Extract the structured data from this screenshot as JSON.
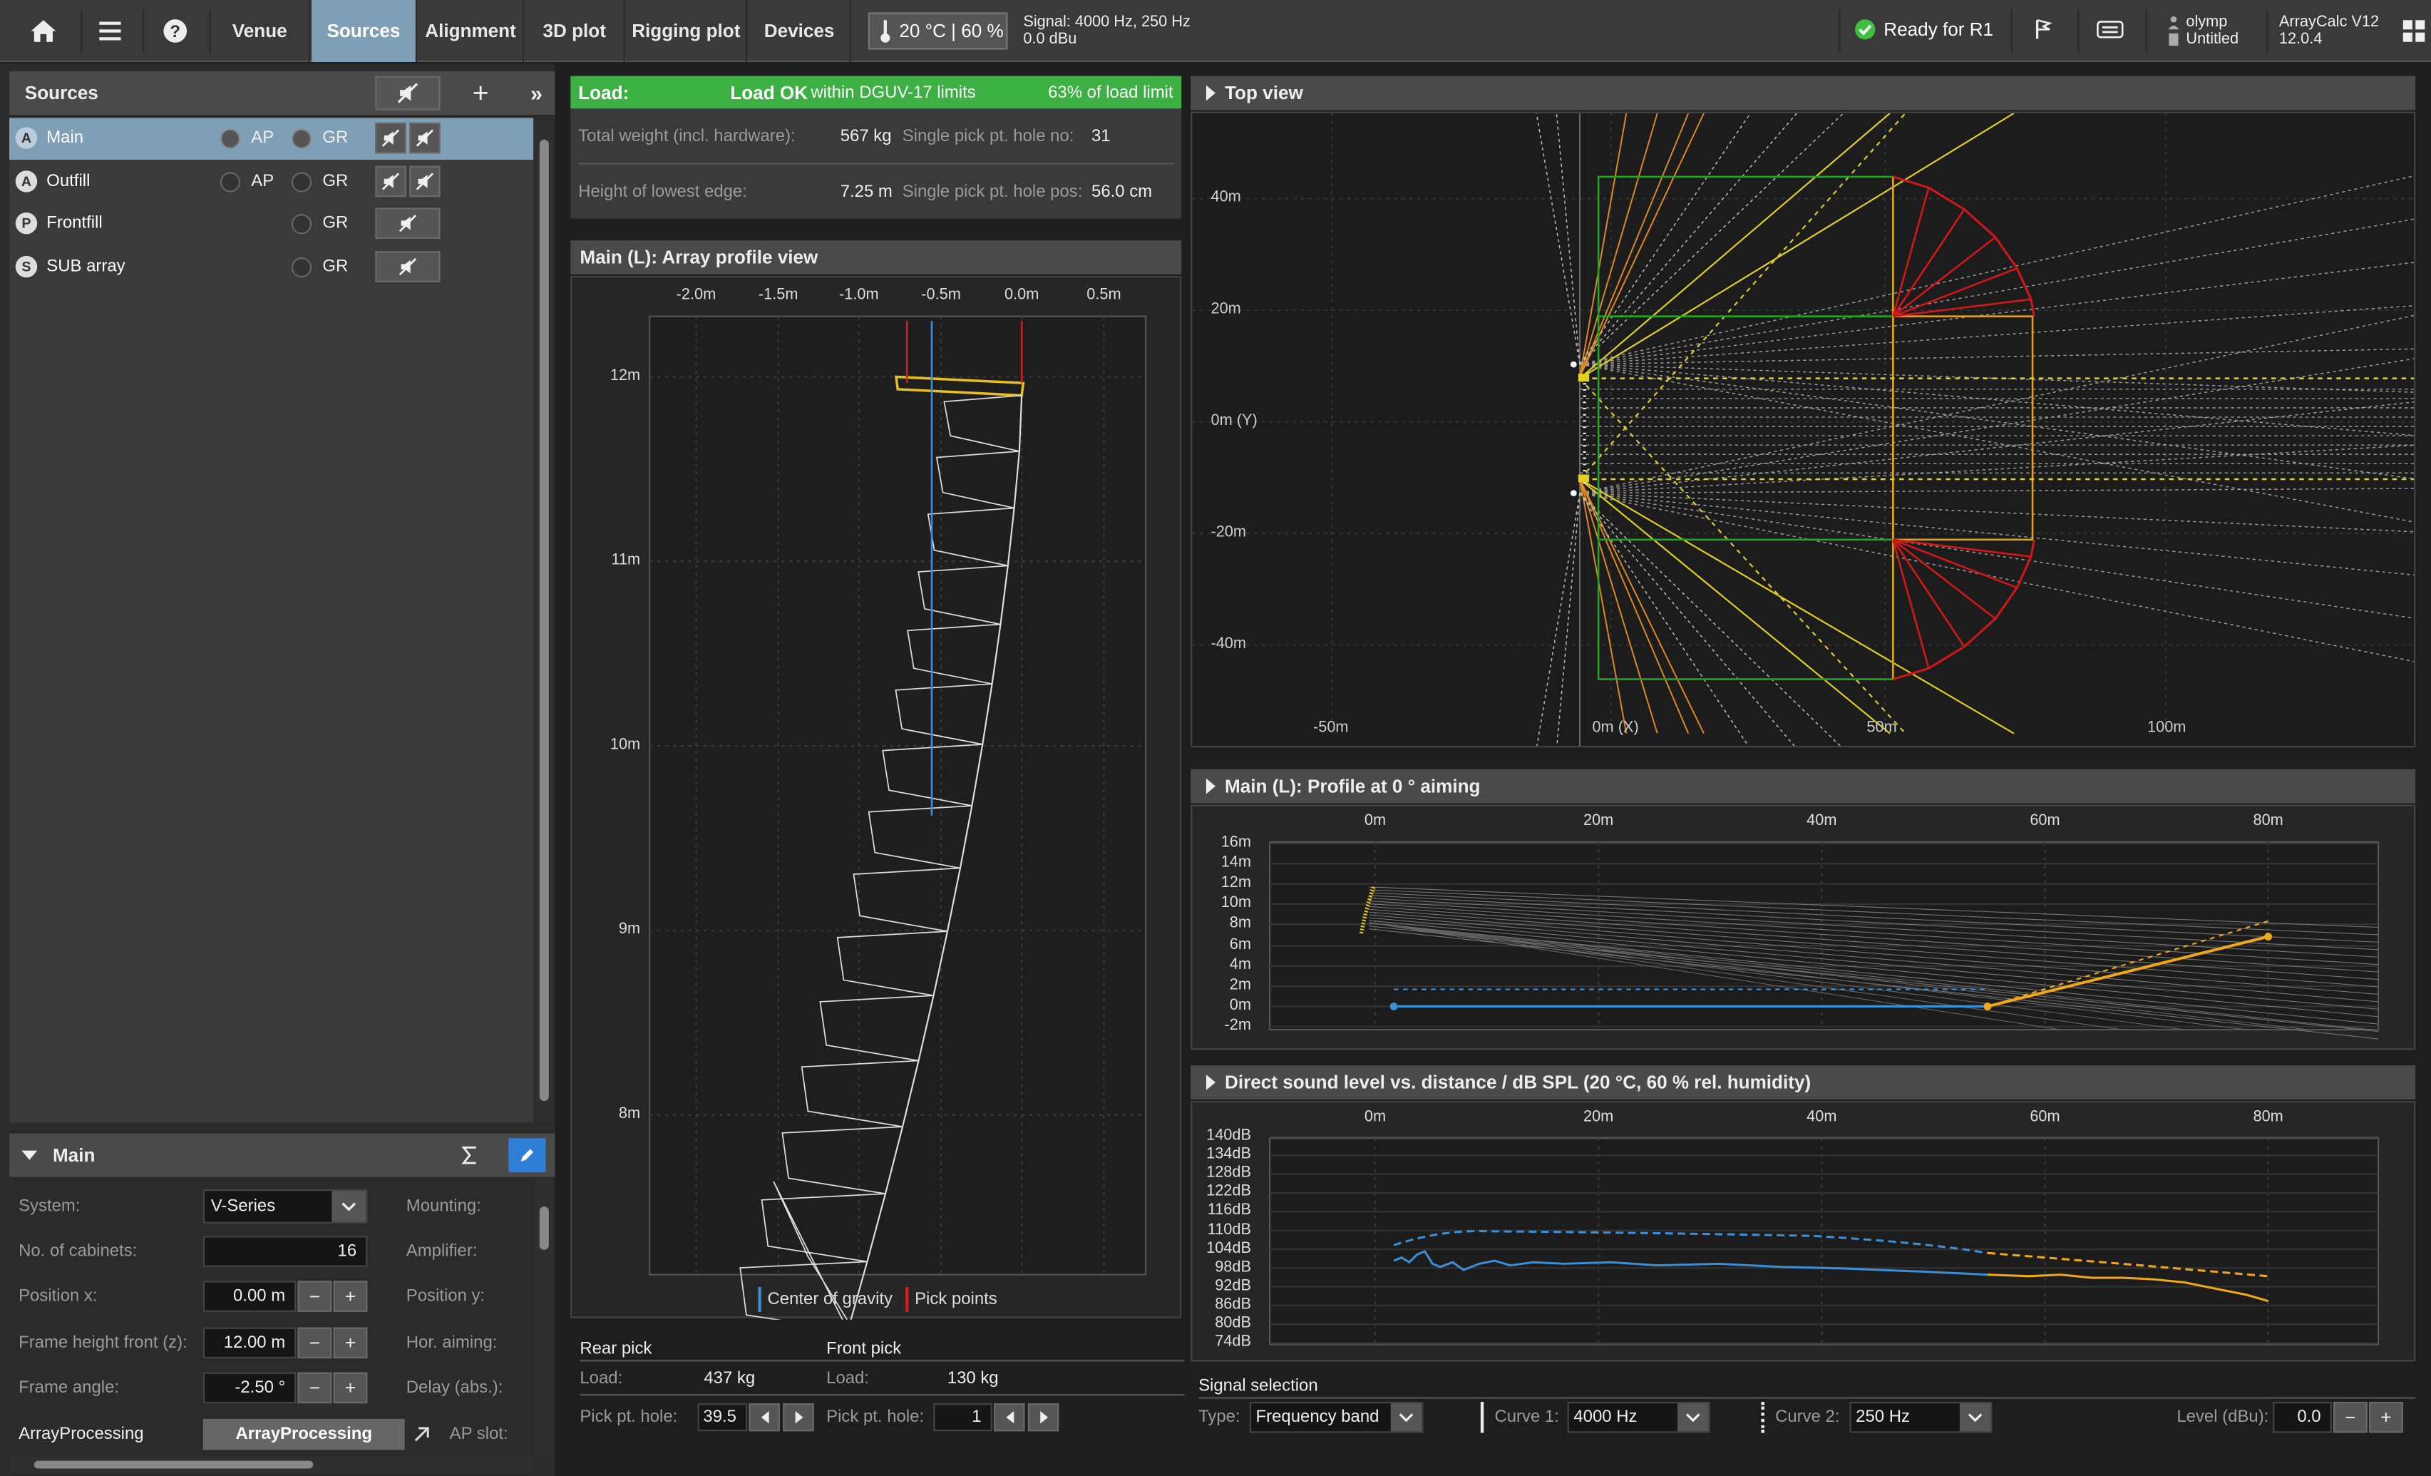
{
  "topbar": {
    "home_icon": "home-icon",
    "menu_icon": "menu-icon",
    "help_icon": "help-icon",
    "tabs": [
      "Venue",
      "Sources",
      "Alignment",
      "3D plot",
      "Rigging plot",
      "Devices"
    ],
    "active_tab": "Sources",
    "climate": "20 °C | 60 %",
    "signal_line1": "Signal: 4000 Hz, 250 Hz",
    "signal_line2": "0.0 dBu",
    "ready": "Ready for R1",
    "user": "olymp",
    "project": "Untitled",
    "app_name": "ArrayCalc V12",
    "app_version": "12.0.4",
    "colors": {
      "active": "#7f9fb6",
      "ready": "#3fbf3f"
    }
  },
  "sources": {
    "title": "Sources",
    "list": [
      {
        "badge": "A",
        "name": "Main",
        "ap": "AP",
        "gr": "GR"
      },
      {
        "badge": "A",
        "name": "Outfill",
        "ap": "AP",
        "gr": "GR"
      },
      {
        "badge": "P",
        "name": "Frontfill",
        "ap": "",
        "gr": "GR"
      },
      {
        "badge": "S",
        "name": "SUB array",
        "ap": "",
        "gr": "GR"
      }
    ]
  },
  "main_panel": {
    "title": "Main",
    "system_label": "System:",
    "system_value": "V-Series",
    "cabinets_label": "No. of cabinets:",
    "cabinets_value": "16",
    "posx_label": "Position x:",
    "posx_value": "0.00 m",
    "frameh_label": "Frame height front (z):",
    "frameh_value": "12.00 m",
    "frame_angle_label": "Frame angle:",
    "frame_angle_value": "-2.50 °",
    "ap_label": "ArrayProcessing",
    "ap_button": "ArrayProcessing",
    "mounting_label": "Mounting:",
    "amplifier_label": "Amplifier:",
    "posy_label": "Position y:",
    "hor_aiming_label": "Hor. aiming:",
    "delay_label": "Delay (abs.):",
    "ap_slot_label": "AP slot:"
  },
  "load": {
    "label": "Load:",
    "status": "Load OK",
    "within": "within DGUV-17 limits",
    "percent": "63% of load limit",
    "total_weight_label": "Total weight (incl. hardware):",
    "total_weight": "567 kg",
    "pick_hole_no_label": "Single pick pt. hole no:",
    "pick_hole_no": "31",
    "lowest_edge_label": "Height of lowest edge:",
    "lowest_edge": "7.25 m",
    "pick_hole_pos_label": "Single pick pt. hole pos:",
    "pick_hole_pos": "56.0 cm",
    "color_ok": "#3cb043"
  },
  "profile": {
    "title": "Main (L): Array profile view",
    "x_ticks": [
      "-2.0m",
      "-1.5m",
      "-1.0m",
      "-0.5m",
      "0.0m",
      "0.5m"
    ],
    "y_ticks": [
      "12m",
      "11m",
      "10m",
      "9m",
      "8m"
    ],
    "legend_cog": "Center of gravity",
    "legend_pick": "Pick points",
    "rear_pick": "Rear pick",
    "front_pick": "Front pick",
    "load_label": "Load:",
    "rear_load": "437 kg",
    "front_load": "130 kg",
    "pick_hole_label": "Pick pt. hole:",
    "rear_hole": "39.5",
    "front_hole": "1"
  },
  "top_view": {
    "title": "Top view",
    "y_ticks": [
      "40m",
      "20m",
      "0m (Y)",
      "-20m",
      "-40m"
    ],
    "x_ticks": [
      "-50m",
      "0m (X)",
      "50m",
      "100m"
    ]
  },
  "profile0": {
    "title": "Main (L): Profile at 0 ° aiming",
    "x_ticks": [
      "0m",
      "20m",
      "40m",
      "60m",
      "80m"
    ],
    "y_ticks": [
      "16m",
      "14m",
      "12m",
      "10m",
      "8m",
      "6m",
      "4m",
      "2m",
      "0m",
      "-2m"
    ]
  },
  "spl": {
    "title": "Direct sound level vs. distance / dB SPL (20 °C, 60 % rel. humidity)",
    "x_ticks": [
      "0m",
      "20m",
      "40m",
      "60m",
      "80m"
    ],
    "y_ticks": [
      "140dB",
      "134dB",
      "128dB",
      "122dB",
      "116dB",
      "110dB",
      "104dB",
      "98dB",
      "92dB",
      "86dB",
      "80dB",
      "74dB"
    ]
  },
  "signal": {
    "title": "Signal selection",
    "type_label": "Type:",
    "type_value": "Frequency band",
    "curve1_label": "Curve 1:",
    "curve1_value": "4000 Hz",
    "curve2_label": "Curve 2:",
    "curve2_value": "250 Hz",
    "level_label": "Level (dBu):",
    "level_value": "0.0"
  }
}
